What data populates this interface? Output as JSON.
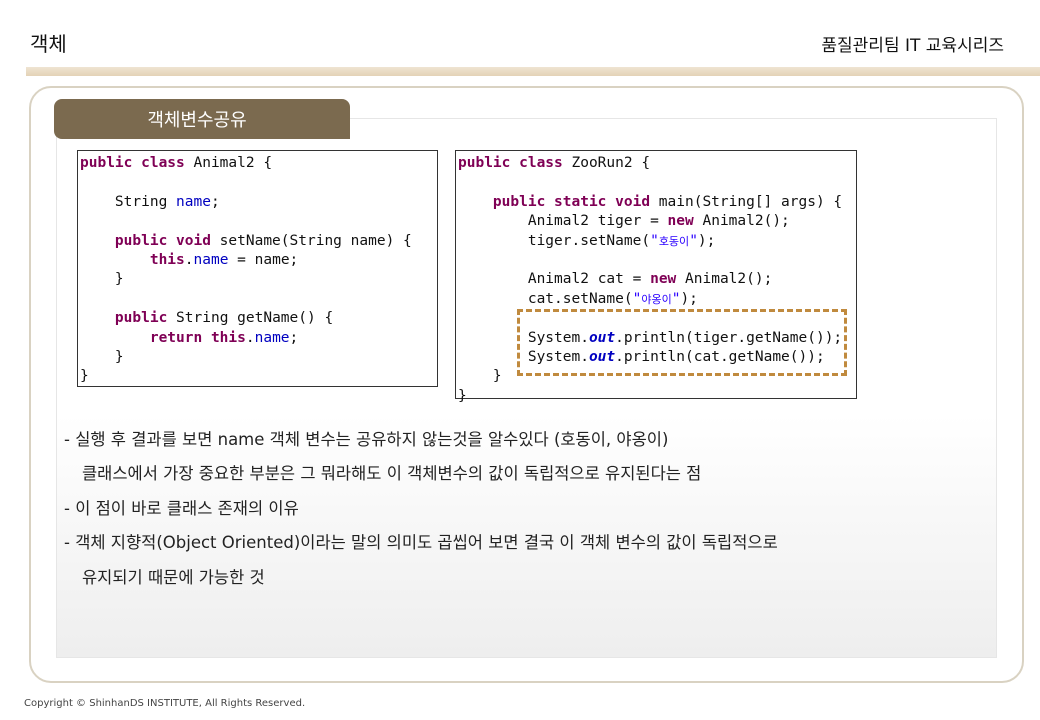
{
  "header": {
    "title": "객체",
    "series": "품질관리팀 IT 교육시리즈"
  },
  "section": {
    "tab_label": "객체변수공유"
  },
  "code_left": {
    "l1_kw": "public class",
    "l1_rest": " Animal2 {",
    "l3_type": "    String ",
    "l3_field": "name",
    "l3_end": ";",
    "l5_kw": "    public void",
    "l5_mid": " setName(String ",
    "l5_param": "name",
    "l5_end": ") {",
    "l6_kw": "        this",
    "l6_dot": ".",
    "l6_field": "name",
    "l6_mid": " = ",
    "l6_param": "name",
    "l6_end": ";",
    "l7": "    }",
    "l9_kw": "    public",
    "l9_rest": " String getName() {",
    "l10_kw": "        return this",
    "l10_dot": ".",
    "l10_field": "name",
    "l10_end": ";",
    "l11": "    }",
    "l12": "}"
  },
  "code_right": {
    "l1_kw": "public class",
    "l1_rest": " ZooRun2 {",
    "l3_kw": "    public static void",
    "l3_mid": " main(String[] ",
    "l3_arg": "args",
    "l3_end": ") {",
    "l4_a": "        Animal2 ",
    "l4_var": "tiger",
    "l4_b": " = ",
    "l4_kw": "new",
    "l4_c": " Animal2();",
    "l5_var": "        tiger",
    "l5_a": ".setName(",
    "l5_q1": "\"",
    "l5_str": "호동이",
    "l5_q2": "\"",
    "l5_end": ");",
    "l7_a": "        Animal2 ",
    "l7_var": "cat",
    "l7_b": " = ",
    "l7_kw": "new",
    "l7_c": " Animal2();",
    "l8_var": "        cat",
    "l8_a": ".setName(",
    "l8_q1": "\"",
    "l8_str": "야옹이",
    "l8_q2": "\"",
    "l8_end": ");",
    "l10_a": "        System.",
    "l10_out": "out",
    "l10_b": ".println(",
    "l10_var": "tiger",
    "l10_c": ".getName());",
    "l11_a": "        System.",
    "l11_out": "out",
    "l11_b": ".println(",
    "l11_var": "cat",
    "l11_c": ".getName());",
    "l12": "    }",
    "l13": "}"
  },
  "notes": [
    "- 실행 후 결과를 보면 name 객체 변수는 공유하지 않는것을 알수있다 (호동이, 야옹이)",
    "클래스에서 가장 중요한 부분은 그 뭐라해도 이 객체변수의 값이 독립적으로 유지된다는 점",
    "- 이 점이 바로 클래스 존재의 이유",
    "- 객체 지향적(Object Oriented)이라는 말의 의미도 곱씹어 보면 결국 이 객체 변수의 값이 독립적으로",
    "유지되기 때문에 가능한 것"
  ],
  "footer": {
    "copyright": "Copyright © ShinhanDS INSTITUTE, All Rights Reserved."
  },
  "colors": {
    "tab_bg": "#7b6a4f",
    "header_bar": "#e8dcc6",
    "keyword": "#7f0055",
    "field": "#0000c0",
    "string": "#2a00ff",
    "highlight_border": "#c08a3e"
  }
}
